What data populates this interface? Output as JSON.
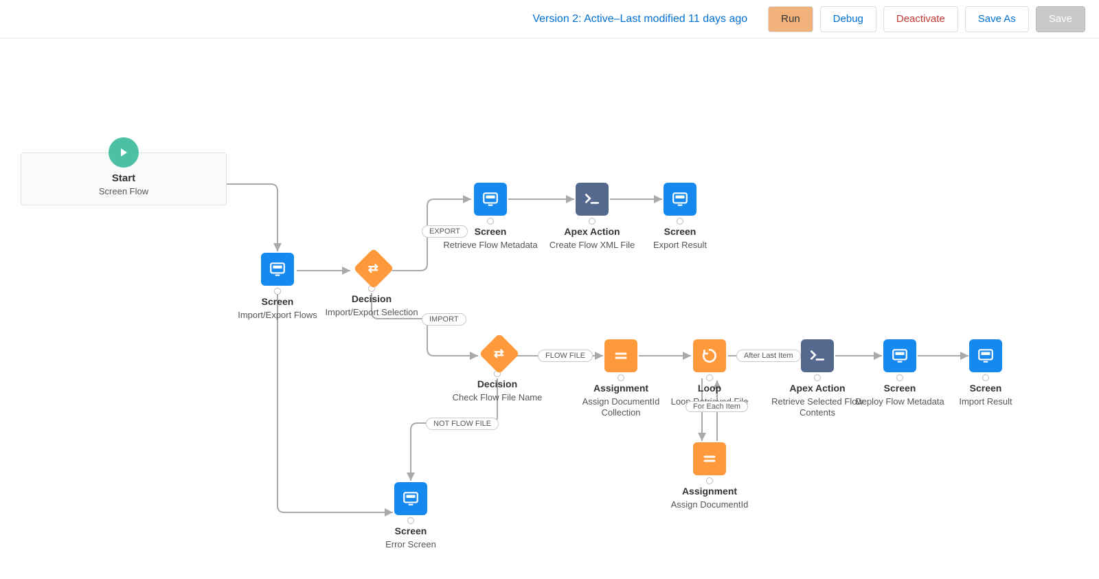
{
  "toolbar": {
    "version": "Version 2: Active–Last modified 11 days ago",
    "run": "Run",
    "debug": "Debug",
    "deactivate": "Deactivate",
    "saveAs": "Save As",
    "save": "Save"
  },
  "start": {
    "title": "Start",
    "sub": "Screen Flow"
  },
  "nodes": [
    {
      "id": "importExport",
      "type": "Screen",
      "title": "Screen",
      "sub": "Import/Export Flows"
    },
    {
      "id": "decision1",
      "type": "Decision",
      "title": "Decision",
      "sub": "Import/Export Selection"
    },
    {
      "id": "retrieveMeta",
      "type": "Screen",
      "title": "Screen",
      "sub": "Retrieve Flow Metadata"
    },
    {
      "id": "createXml",
      "type": "Apex Action",
      "title": "Apex Action",
      "sub": "Create Flow XML File"
    },
    {
      "id": "exportResult",
      "type": "Screen",
      "title": "Screen",
      "sub": "Export Result"
    },
    {
      "id": "decision2",
      "type": "Decision",
      "title": "Decision",
      "sub": "Check Flow File Name"
    },
    {
      "id": "assignCollection",
      "type": "Assignment",
      "title": "Assignment",
      "sub": "Assign DocumentId Collection"
    },
    {
      "id": "loop",
      "type": "Loop",
      "title": "Loop",
      "sub": "Loop Retrieved File"
    },
    {
      "id": "assignDoc",
      "type": "Assignment",
      "title": "Assignment",
      "sub": "Assign DocumentId"
    },
    {
      "id": "retrieveContents",
      "type": "Apex Action",
      "title": "Apex Action",
      "sub": "Retrieve Selected Flow Contents"
    },
    {
      "id": "deployMeta",
      "type": "Screen",
      "title": "Screen",
      "sub": "Deploy Flow Metadata"
    },
    {
      "id": "importResult",
      "type": "Screen",
      "title": "Screen",
      "sub": "Import Result"
    },
    {
      "id": "errorScreen",
      "type": "Screen",
      "title": "Screen",
      "sub": "Error Screen"
    }
  ],
  "edges": {
    "export": "EXPORT",
    "import": "IMPORT",
    "flowFile": "FLOW FILE",
    "notFlowFile": "NOT FLOW FILE",
    "afterLast": "After Last Item",
    "forEach": "For Each Item"
  },
  "colors": {
    "screen": "#1589ee",
    "apex": "#54698d",
    "orange": "#ff9a3c",
    "start": "#4bc0a5",
    "link": "#0070d2",
    "danger": "#c23934"
  }
}
